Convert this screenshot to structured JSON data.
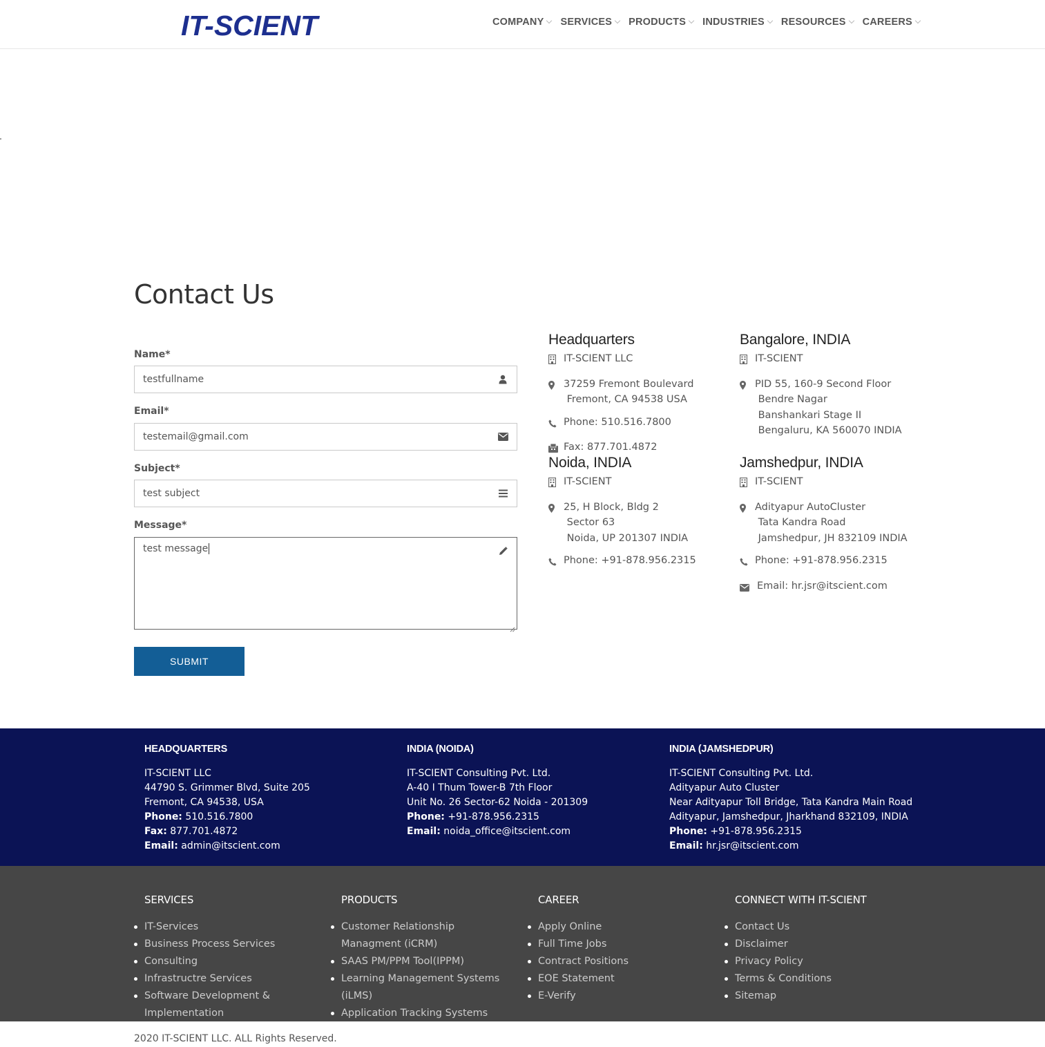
{
  "header": {
    "logo": "IT-SCIENT",
    "nav": [
      "COMPANY",
      "SERVICES",
      "PRODUCTS",
      "INDUSTRIES",
      "RESOURCES",
      "CAREERS"
    ]
  },
  "contact": {
    "title": "Contact Us",
    "name_label": "Name*",
    "name_value": "testfullname",
    "email_label": "Email*",
    "email_value": "testemail@gmail.com",
    "subject_label": "Subject*",
    "subject_value": "test subject",
    "message_label": "Message*",
    "message_value": "test message",
    "submit_label": "SUBMIT"
  },
  "offices": {
    "hq": {
      "title": "Headquarters",
      "company": "IT-SCIENT LLC",
      "address": "37259 Fremont Boulevard\n Fremont, CA 94538 USA",
      "phone": "Phone: 510.516.7800",
      "fax": "Fax: 877.701.4872"
    },
    "bangalore": {
      "title": "Bangalore, INDIA",
      "company": "IT-SCIENT",
      "address": "PID 55, 160-9 Second Floor\n Bendre Nagar\n Banshankari Stage II\n Bengaluru, KA 560070 INDIA"
    },
    "noida": {
      "title": "Noida, INDIA",
      "company": "IT-SCIENT",
      "address": "25, H Block, Bldg 2\n Sector 63\n Noida, UP 201307 INDIA",
      "phone": "Phone: +91-878.956.2315"
    },
    "jamshedpur": {
      "title": "Jamshedpur, INDIA",
      "company": "IT-SCIENT",
      "address": "Adityapur AutoCluster\n Tata Kandra Road\n Jamshedpur, JH 832109 INDIA",
      "phone": "Phone: +91-878.956.2315",
      "email": "Email: hr.jsr@itscient.com"
    }
  },
  "footer_blue": {
    "hq": {
      "title": "HEADQUARTERS",
      "lines": [
        "IT-SCIENT LLC",
        "44790 S. Grimmer Blvd, Suite 205",
        "Fremont, CA 94538, USA"
      ],
      "phone_label": "Phone:",
      "phone": "510.516.7800",
      "fax_label": "Fax:",
      "fax": "877.701.4872",
      "email_label": "Email:",
      "email": "admin@itscient.com"
    },
    "noida": {
      "title": "INDIA (NOIDA)",
      "lines": [
        "IT-SCIENT Consulting Pvt. Ltd.",
        "A-40 I Thum Tower-B 7th Floor",
        "Unit No. 26 Sector-62 Noida - 201309"
      ],
      "phone_label": "Phone:",
      "phone": "+91-878.956.2315",
      "email_label": "Email:",
      "email": "noida_office@itscient.com"
    },
    "jamshedpur": {
      "title": "INDIA (JAMSHEDPUR)",
      "lines": [
        "IT-SCIENT Consulting Pvt. Ltd.",
        "Adityapur Auto Cluster",
        "Near Adityapur Toll Bridge, Tata Kandra Main Road",
        "Adityapur, Jamshedpur, Jharkhand 832109, INDIA"
      ],
      "phone_label": "Phone:",
      "phone": "+91-878.956.2315",
      "email_label": "Email:",
      "email": "hr.jsr@itscient.com"
    }
  },
  "footer_grey": {
    "services": {
      "title": "SERVICES",
      "items": [
        "IT-Services",
        "Business Process Services",
        "Consulting",
        "Infrastructre Services",
        "Software Development & Implementation"
      ]
    },
    "products": {
      "title": "PRODUCTS",
      "items": [
        "Customer Relationship Managment (iCRM)",
        "SAAS PM/PPM Tool(IPPM)",
        "Learning Management Systems (iLMS)",
        "Application Tracking Systems"
      ]
    },
    "career": {
      "title": "CAREER",
      "items": [
        "Apply Online",
        "Full Time Jobs",
        "Contract Positions",
        "EOE Statement",
        "E-Verify"
      ]
    },
    "connect": {
      "title": "CONNECT WITH IT-SCIENT",
      "items": [
        "Contact Us",
        "Disclaimer",
        "Privacy Policy",
        "Terms & Conditions",
        "Sitemap"
      ]
    }
  },
  "copyright": "2020 IT-SCIENT LLC. ALL Rights Reserved.",
  "colors": {
    "brand": "#1d2f8f",
    "submit": "#135e96",
    "footer_blue": "#0b1355",
    "footer_grey": "#464646"
  }
}
